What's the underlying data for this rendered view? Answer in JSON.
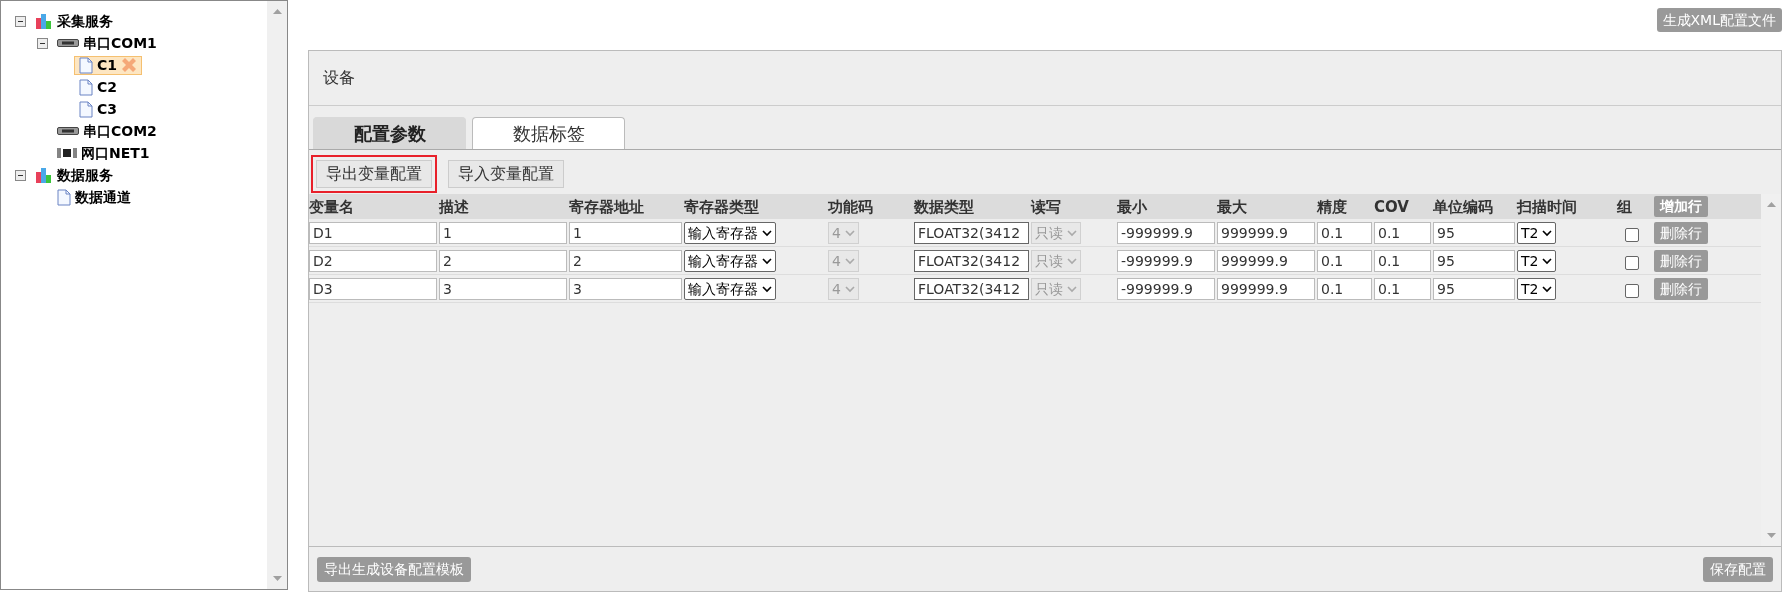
{
  "tree": [
    {
      "label": "采集服务",
      "kind": "service",
      "expanded": true,
      "selected": false,
      "children": [
        {
          "label": "串口COM1",
          "kind": "serial",
          "expanded": true,
          "selected": false,
          "children": [
            {
              "label": "C1",
              "kind": "file",
              "selected": true
            },
            {
              "label": "C2",
              "kind": "file",
              "selected": false
            },
            {
              "label": "C3",
              "kind": "file",
              "selected": false
            }
          ]
        },
        {
          "label": "串口COM2",
          "kind": "serial",
          "selected": false
        },
        {
          "label": "网口NET1",
          "kind": "net",
          "selected": false
        }
      ]
    },
    {
      "label": "数据服务",
      "kind": "service",
      "expanded": true,
      "selected": false,
      "children": [
        {
          "label": "数据通道",
          "kind": "file",
          "selected": false
        }
      ]
    }
  ],
  "generate_button": "生成XML配置文件",
  "panel_title": "设备",
  "tabs": [
    {
      "label": "配置参数",
      "selected": false
    },
    {
      "label": "数据标签",
      "selected": true
    }
  ],
  "actions": [
    {
      "label": "导出变量配置",
      "highlighted": true
    },
    {
      "label": "导入变量配置",
      "highlighted": false
    }
  ],
  "columns": [
    "变量名",
    "描述",
    "寄存器地址",
    "寄存器类型",
    "功能码",
    "数据类型",
    "读写",
    "最小",
    "最大",
    "精度",
    "COV",
    "单位编码",
    "扫描时间",
    "组"
  ],
  "add_row_button": "增加行",
  "rows": [
    {
      "cells": [
        {
          "kind": "input",
          "value": "D1"
        },
        {
          "kind": "input",
          "value": "1"
        },
        {
          "kind": "input",
          "value": "1"
        },
        {
          "kind": "select",
          "value": "输入寄存器"
        },
        {
          "kind": "select",
          "value": "4",
          "disabled": true
        },
        {
          "kind": "clipped",
          "value": "FLOAT32(3412"
        },
        {
          "kind": "select",
          "value": "只读",
          "disabled": true
        },
        {
          "kind": "input",
          "value": "-999999.9"
        },
        {
          "kind": "input",
          "value": "999999.9"
        },
        {
          "kind": "input",
          "value": "0.1"
        },
        {
          "kind": "input",
          "value": "0.1"
        },
        {
          "kind": "input",
          "value": "95"
        },
        {
          "kind": "select",
          "value": "T2"
        },
        {
          "kind": "checkbox",
          "checked": false
        },
        {
          "kind": "button",
          "value": "删除行"
        }
      ]
    },
    {
      "cells": [
        {
          "kind": "input",
          "value": "D2"
        },
        {
          "kind": "input",
          "value": "2"
        },
        {
          "kind": "input",
          "value": "2"
        },
        {
          "kind": "select",
          "value": "输入寄存器"
        },
        {
          "kind": "select",
          "value": "4",
          "disabled": true
        },
        {
          "kind": "clipped",
          "value": "FLOAT32(3412"
        },
        {
          "kind": "select",
          "value": "只读",
          "disabled": true
        },
        {
          "kind": "input",
          "value": "-999999.9"
        },
        {
          "kind": "input",
          "value": "999999.9"
        },
        {
          "kind": "input",
          "value": "0.1"
        },
        {
          "kind": "input",
          "value": "0.1"
        },
        {
          "kind": "input",
          "value": "95"
        },
        {
          "kind": "select",
          "value": "T2"
        },
        {
          "kind": "checkbox",
          "checked": false
        },
        {
          "kind": "button",
          "value": "删除行"
        }
      ]
    },
    {
      "cells": [
        {
          "kind": "input",
          "value": "D3"
        },
        {
          "kind": "input",
          "value": "3"
        },
        {
          "kind": "input",
          "value": "3"
        },
        {
          "kind": "select",
          "value": "输入寄存器"
        },
        {
          "kind": "select",
          "value": "4",
          "disabled": true
        },
        {
          "kind": "clipped",
          "value": "FLOAT32(3412"
        },
        {
          "kind": "select",
          "value": "只读",
          "disabled": true
        },
        {
          "kind": "input",
          "value": "-999999.9"
        },
        {
          "kind": "input",
          "value": "999999.9"
        },
        {
          "kind": "input",
          "value": "0.1"
        },
        {
          "kind": "input",
          "value": "0.1"
        },
        {
          "kind": "input",
          "value": "95"
        },
        {
          "kind": "select",
          "value": "T2"
        },
        {
          "kind": "checkbox",
          "checked": false
        },
        {
          "kind": "button",
          "value": "删除行"
        }
      ]
    }
  ],
  "footer_buttons": [
    {
      "label": "导出生成设备配置模板"
    },
    {
      "label": "保存配置"
    }
  ]
}
